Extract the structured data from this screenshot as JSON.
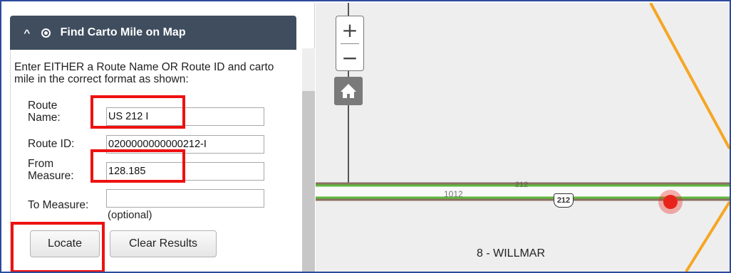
{
  "panel": {
    "title": "Find Carto Mile on Map",
    "collapse_icon": "chevron-up-icon",
    "title_icon": "target-icon",
    "instructions": "Enter EITHER a Route Name OR Route ID and carto mile in the correct format as shown:"
  },
  "form": {
    "route_name_label_line1": "Route",
    "route_name_label_line2": "Name:",
    "route_name_value": "US 212 I",
    "route_id_label": "Route ID:",
    "route_id_value": "0200000000000212-I",
    "from_measure_label_line1": "From",
    "from_measure_label_line2": "Measure:",
    "from_measure_value": "128.185",
    "to_measure_label": "To Measure:",
    "to_measure_value": "",
    "to_measure_hint": "(optional)"
  },
  "buttons": {
    "locate": "Locate",
    "clear": "Clear Results"
  },
  "map": {
    "zoom_in": "+",
    "zoom_out": "−",
    "home_icon": "home-icon",
    "road_label": "1012",
    "highway_shield_a": "212",
    "highway_shield_b": "212",
    "district_label": "8 - WILLMAR",
    "colors": {
      "background": "#eeeeee",
      "route_green": "#5fb83d",
      "route_brown": "#8a7060",
      "orange_road": "#f5a623",
      "location_marker": "#e8231b"
    }
  },
  "highlight_color": "#ee1111"
}
